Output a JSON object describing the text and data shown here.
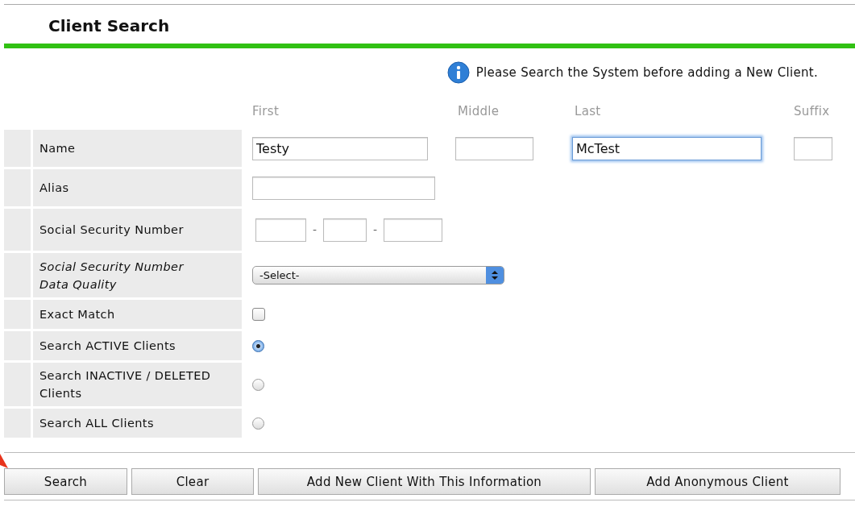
{
  "header": {
    "title": "Client Search"
  },
  "notice": "Please Search the System before adding a New Client.",
  "name_columns": [
    "First",
    "Middle",
    "Last",
    "Suffix"
  ],
  "rows": [
    {
      "kind": "name",
      "label": "Name",
      "italic": false,
      "fields": [
        {
          "value": "Testy",
          "focused": false
        },
        {
          "focused": false
        },
        {
          "value": "McTest",
          "focused": true
        },
        {
          "focused": false
        }
      ]
    },
    {
      "kind": "text",
      "label": "Alias",
      "italic": false
    },
    {
      "kind": "ssn",
      "label": "Social Security Number",
      "italic": false,
      "separators": [
        "-",
        "-"
      ]
    },
    {
      "kind": "select",
      "label": "Social Security Number Data Quality",
      "italic": true,
      "value": "-Select-"
    },
    {
      "kind": "checkbox",
      "label": "Exact Match",
      "italic": false,
      "checked": false
    },
    {
      "kind": "radio",
      "label": "Search ACTIVE Clients",
      "italic": false,
      "selected": true
    },
    {
      "kind": "radio",
      "label": "Search INACTIVE / DELETED Clients",
      "italic": false,
      "selected": false
    },
    {
      "kind": "radio",
      "label": "Search ALL Clients",
      "italic": false,
      "selected": false
    }
  ],
  "buttons": [
    "Search",
    "Clear",
    "Add New Client With This Information",
    "Add Anonymous Client"
  ]
}
